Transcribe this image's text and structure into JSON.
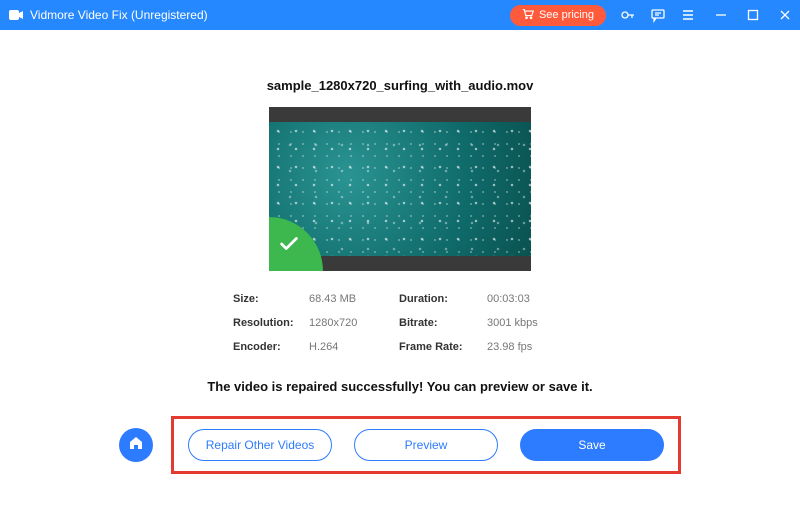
{
  "titlebar": {
    "app_title": "Vidmore Video Fix (Unregistered)",
    "see_pricing_label": "See pricing"
  },
  "file": {
    "name": "sample_1280x720_surfing_with_audio.mov"
  },
  "meta": {
    "size_label": "Size:",
    "size_value": "68.43 MB",
    "duration_label": "Duration:",
    "duration_value": "00:03:03",
    "resolution_label": "Resolution:",
    "resolution_value": "1280x720",
    "bitrate_label": "Bitrate:",
    "bitrate_value": "3001 kbps",
    "encoder_label": "Encoder:",
    "encoder_value": "H.264",
    "framerate_label": "Frame Rate:",
    "framerate_value": "23.98 fps"
  },
  "status_message": "The video is repaired successfully! You can preview or save it.",
  "actions": {
    "repair_other": "Repair Other Videos",
    "preview": "Preview",
    "save": "Save"
  }
}
